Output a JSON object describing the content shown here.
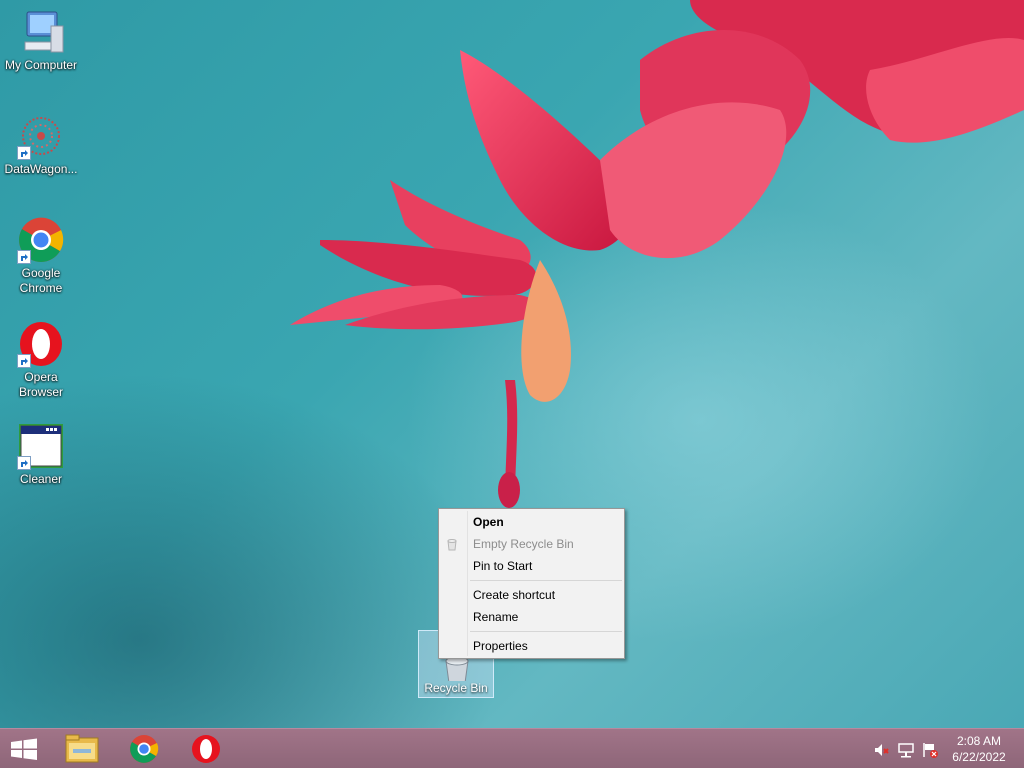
{
  "desktop": {
    "icons": [
      {
        "label": "My Computer",
        "icon": "computer-icon"
      },
      {
        "label": "DataWagon...",
        "icon": "datawagon-icon"
      },
      {
        "label": "Google Chrome",
        "icon": "chrome-icon"
      },
      {
        "label": "Opera Browser",
        "icon": "opera-icon"
      },
      {
        "label": "Cleaner",
        "icon": "cleaner-icon"
      }
    ],
    "recycle_bin": {
      "label": "Recycle Bin",
      "icon": "recycle-bin-icon"
    }
  },
  "context_menu": {
    "items": [
      {
        "label": "Open",
        "bold": true,
        "disabled": false
      },
      {
        "label": "Empty Recycle Bin",
        "bold": false,
        "disabled": true
      },
      {
        "label": "Pin to Start",
        "bold": false,
        "disabled": false
      },
      {
        "label": "Create shortcut",
        "bold": false,
        "disabled": false
      },
      {
        "label": "Rename",
        "bold": false,
        "disabled": false
      },
      {
        "label": "Properties",
        "bold": false,
        "disabled": false
      }
    ]
  },
  "taskbar": {
    "pinned": [
      "start-windows-icon",
      "file-explorer-icon",
      "chrome-icon",
      "opera-icon"
    ],
    "tray": [
      "speaker-muted-icon",
      "network-icon",
      "action-center-flag-icon"
    ],
    "clock": {
      "time": "2:08 AM",
      "date": "6/22/2022"
    }
  },
  "colors": {
    "taskbar": "#94697d",
    "wallpaper": "#3aa6b1",
    "flower": "#e23a5c",
    "menu_bg": "#f2f2f2"
  }
}
